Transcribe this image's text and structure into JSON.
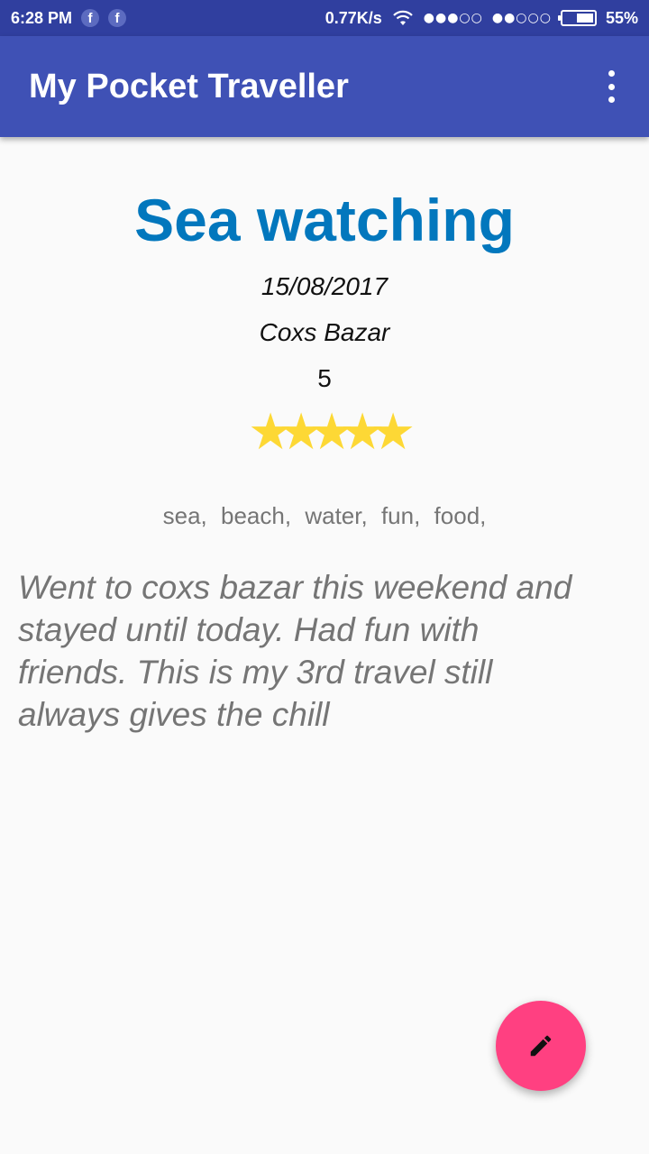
{
  "status_bar": {
    "time": "6:28 PM",
    "network_speed": "0.77K/s",
    "signal1": "●●●○○",
    "signal2": "●●○○○",
    "battery_text": "55%",
    "battery_level": 0.55,
    "notification_icons": [
      "facebook-icon",
      "facebook-icon"
    ],
    "fb_glyph": "f"
  },
  "app_bar": {
    "title": "My Pocket Traveller",
    "color": "#3f51b5"
  },
  "entry": {
    "title": "Sea watching",
    "date": "15/08/2017",
    "location": "Coxs Bazar",
    "rating": "5",
    "stars": [
      "★",
      "★",
      "★",
      "★",
      "★"
    ],
    "tags": [
      "sea,",
      "beach,",
      "water,",
      "fun,",
      "food,"
    ],
    "description": "Went to coxs bazar this weekend and stayed until today. Had fun with friends. This is my 3rd travel still always gives the chill"
  },
  "fab": {
    "icon": "pencil-icon",
    "color": "#ff4081"
  }
}
